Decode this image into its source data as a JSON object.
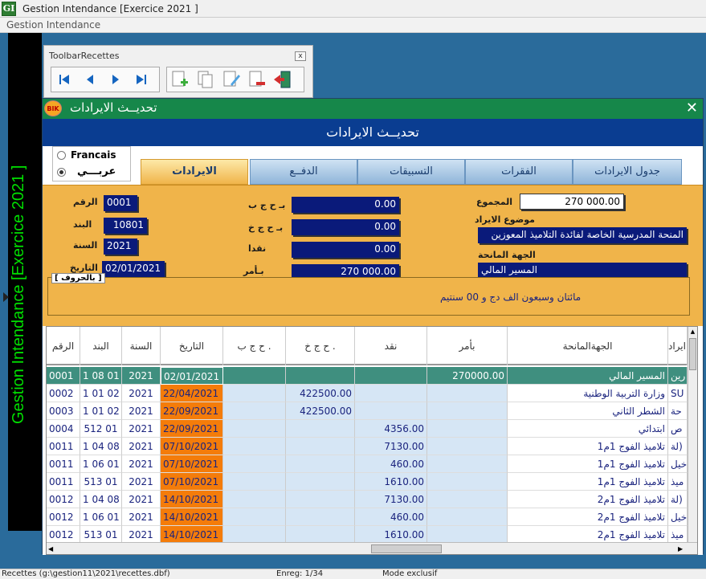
{
  "window": {
    "title": "Gestion Intendance [Exercice  2021 ]",
    "logo": "GI"
  },
  "menu": {
    "label": "Gestion Intendance"
  },
  "side_label": "Gestion Intendance [Exercice  2021 ]",
  "toolbar": {
    "title": "ToolbarRecettes",
    "close": "x",
    "nav": [
      "first-icon",
      "previous-icon",
      "next-icon",
      "last-icon"
    ],
    "actions": [
      "add-icon",
      "copy-icon",
      "edit-icon",
      "delete-icon",
      "exit-icon"
    ]
  },
  "form": {
    "logo": "BIK",
    "title": "تحديــث  الايرادات",
    "close": "✕",
    "header": "تحديــث الايرادات",
    "lang": {
      "fr": "Francais",
      "ar": "عربـــي"
    },
    "tabs": [
      "الايرادات",
      "الدفــع",
      "التسبيقات",
      "الفقرات",
      "جدول الايرادات"
    ],
    "fields": {
      "raqm_label": "الرقم",
      "raqm": "0001",
      "band_label": "البند",
      "band": "10801",
      "sana_label": "السنة",
      "sana": "2021",
      "tarikh_label": "التاريخ",
      "tarikh": "02/01/2021",
      "ccp_label": "بـ ح ج ب",
      "ccp": "0.00",
      "cct_label": "بـ ح ج خ",
      "cct": "0.00",
      "naqd_label": "نقدا",
      "naqd": "0.00",
      "amr_label": "بـأمر",
      "amr": "270 000.00",
      "total_label": "المجموع",
      "total": "270 000.00",
      "mawdou_label": "موضوع الايراد",
      "mawdou": "المنحة المدرسية الخاصة لفائدة التلاميذ المعوزين",
      "jiha_label": "الجهة المانحة",
      "jiha": "المسير المالي",
      "words_label": "[ بالحروف ]",
      "words": "مائتان وسبعون  الف دج و 00 سنتيم"
    }
  },
  "grid": {
    "headers": [
      "الرقم",
      "البند",
      "السنة",
      "التاريخ",
      "ح ج ب .",
      "ح ج خ .",
      "نقد",
      "بأمر",
      "الجهةالمانحة",
      "ايراد"
    ],
    "rows": [
      [
        "0001",
        "1 08 01",
        "2021",
        "02/01/2021",
        "",
        "",
        "",
        "270000.00",
        "المسير المالي",
        "رين"
      ],
      [
        "0002",
        "1 01 02",
        "2021",
        "22/04/2021",
        "",
        "422500.00",
        "",
        "",
        "وزارة التربية الوطنية",
        "SU"
      ],
      [
        "0003",
        "1 01 02",
        "2021",
        "22/09/2021",
        "",
        "422500.00",
        "",
        "",
        "الشطر الثاني",
        "حة"
      ],
      [
        "0004",
        "512 01",
        "2021",
        "22/09/2021",
        "",
        "",
        "4356.00",
        "",
        "ابتدائي",
        "ص"
      ],
      [
        "0011",
        "1 04 08",
        "2021",
        "07/10/2021",
        "",
        "",
        "7130.00",
        "",
        "تلاميذ الفوج 1م1",
        "لة)"
      ],
      [
        "0011",
        "1 06 01",
        "2021",
        "07/10/2021",
        "",
        "",
        "460.00",
        "",
        "تلاميذ الفوج 1م1",
        "خيل"
      ],
      [
        "0011",
        "513 01",
        "2021",
        "07/10/2021",
        "",
        "",
        "1610.00",
        "",
        "تلاميذ الفوج 1م1",
        "ميذ"
      ],
      [
        "0012",
        "1 04 08",
        "2021",
        "14/10/2021",
        "",
        "",
        "7130.00",
        "",
        "تلاميذ الفوج 1م2",
        "لة)"
      ],
      [
        "0012",
        "1 06 01",
        "2021",
        "14/10/2021",
        "",
        "",
        "460.00",
        "",
        "تلاميذ الفوج 1م2",
        "خيل"
      ],
      [
        "0012",
        "513 01",
        "2021",
        "14/10/2021",
        "",
        "",
        "1610.00",
        "",
        "تلاميذ الفوج 1م2",
        "ميذ"
      ]
    ]
  },
  "status": {
    "file": "Recettes (g:\\gestion11\\2021\\recettes.dbf)",
    "record": "Enreg: 1/34",
    "mode": "Mode exclusif"
  },
  "colors": {
    "title_green": "#16874a",
    "header_blue": "#0a3d91",
    "panel_orange": "#f0b44a",
    "field_navy": "#0a1a7a",
    "date_orange": "#f47c0a",
    "selected_teal": "#3f8f7f"
  }
}
